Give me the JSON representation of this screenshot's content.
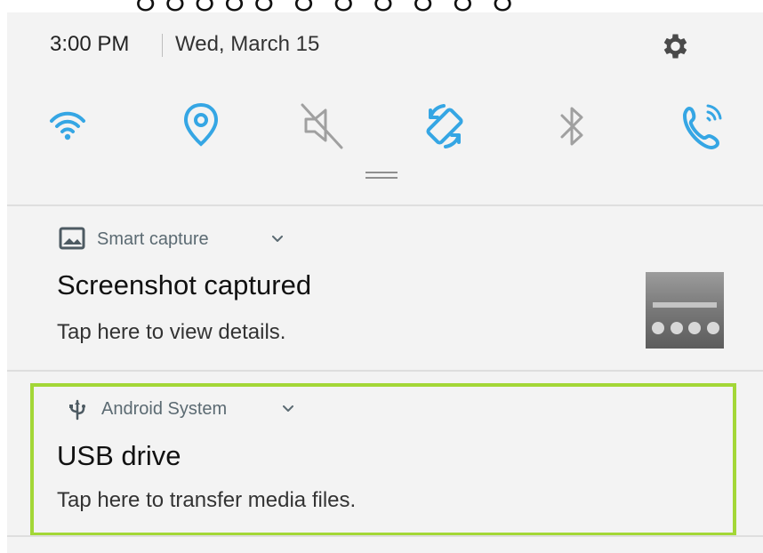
{
  "status": {
    "time": "3:00 PM",
    "date": "Wed, March 15"
  },
  "quick_settings": [
    {
      "name": "wifi",
      "state": "on",
      "color": "#35a6e4"
    },
    {
      "name": "location",
      "state": "on",
      "color": "#35a6e4"
    },
    {
      "name": "sound",
      "state": "muted",
      "color": "#a0a0a0"
    },
    {
      "name": "auto-rotate",
      "state": "on",
      "color": "#35a6e4"
    },
    {
      "name": "bluetooth",
      "state": "off",
      "color": "#a0a0a0"
    },
    {
      "name": "wifi-calling",
      "state": "on",
      "color": "#35a6e4"
    }
  ],
  "notifications": [
    {
      "app": "Smart capture",
      "title": "Screenshot captured",
      "text": "Tap here to view details."
    },
    {
      "app": "Android System",
      "title": "USB drive",
      "text": "Tap here to transfer media files."
    }
  ],
  "colors": {
    "accent": "#35a6e4",
    "highlight": "#a3d737",
    "panel": "#f3f3f3"
  }
}
